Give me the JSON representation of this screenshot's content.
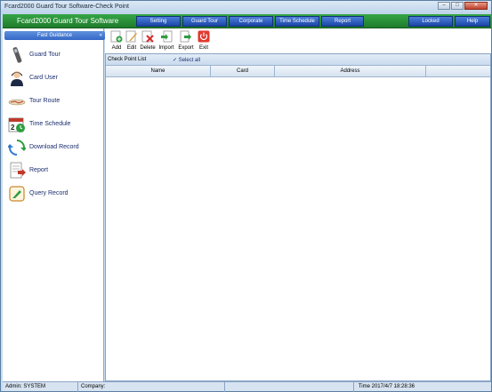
{
  "window": {
    "title": "Fcard2000 Guard Tour Software-Check Point",
    "controls": [
      "minimize",
      "maximize",
      "close"
    ]
  },
  "header": {
    "brand": "Fcard2000 Guard Tour Software",
    "menu": [
      {
        "label": "Setting"
      },
      {
        "label": "Guard Tour"
      },
      {
        "label": "Corporate"
      },
      {
        "label": "Time Schedule"
      },
      {
        "label": "Report"
      }
    ],
    "locked_label": "Locked",
    "help_label": "Help"
  },
  "sidebar": {
    "title": "Fast Guidance",
    "collapse_glyph": "«",
    "items": [
      {
        "label": "Guard Tour",
        "icon": "guard-tour-device-icon"
      },
      {
        "label": "Card User",
        "icon": "card-user-icon"
      },
      {
        "label": "Tour Route",
        "icon": "tour-route-icon"
      },
      {
        "label": "Time Schedule",
        "icon": "calendar-icon"
      },
      {
        "label": "Download Record",
        "icon": "download-refresh-icon"
      },
      {
        "label": "Report",
        "icon": "report-icon"
      },
      {
        "label": "Query Record",
        "icon": "query-record-icon"
      }
    ]
  },
  "toolbar": {
    "buttons": [
      {
        "label": "Add",
        "icon": "add-icon"
      },
      {
        "label": "Edit",
        "icon": "edit-icon"
      },
      {
        "label": "Delete",
        "icon": "delete-icon"
      },
      {
        "label": "Import",
        "icon": "import-icon"
      },
      {
        "label": "Export",
        "icon": "export-icon"
      },
      {
        "label": "Exit",
        "icon": "exit-icon"
      }
    ]
  },
  "list": {
    "caption": "Check Point List",
    "select_all_label": "Select all",
    "columns": [
      "Name",
      "Card",
      "Address"
    ],
    "rows": []
  },
  "status": {
    "admin": "Admin: SYSTEM",
    "company": "Company:",
    "time": "Time 2017/4/7 18:28:36"
  },
  "colors": {
    "header_green": "#2a9239",
    "nav_blue": "#2a5bc0",
    "sidebar_head": "#4a7ed3",
    "frame": "#c9dcee"
  }
}
